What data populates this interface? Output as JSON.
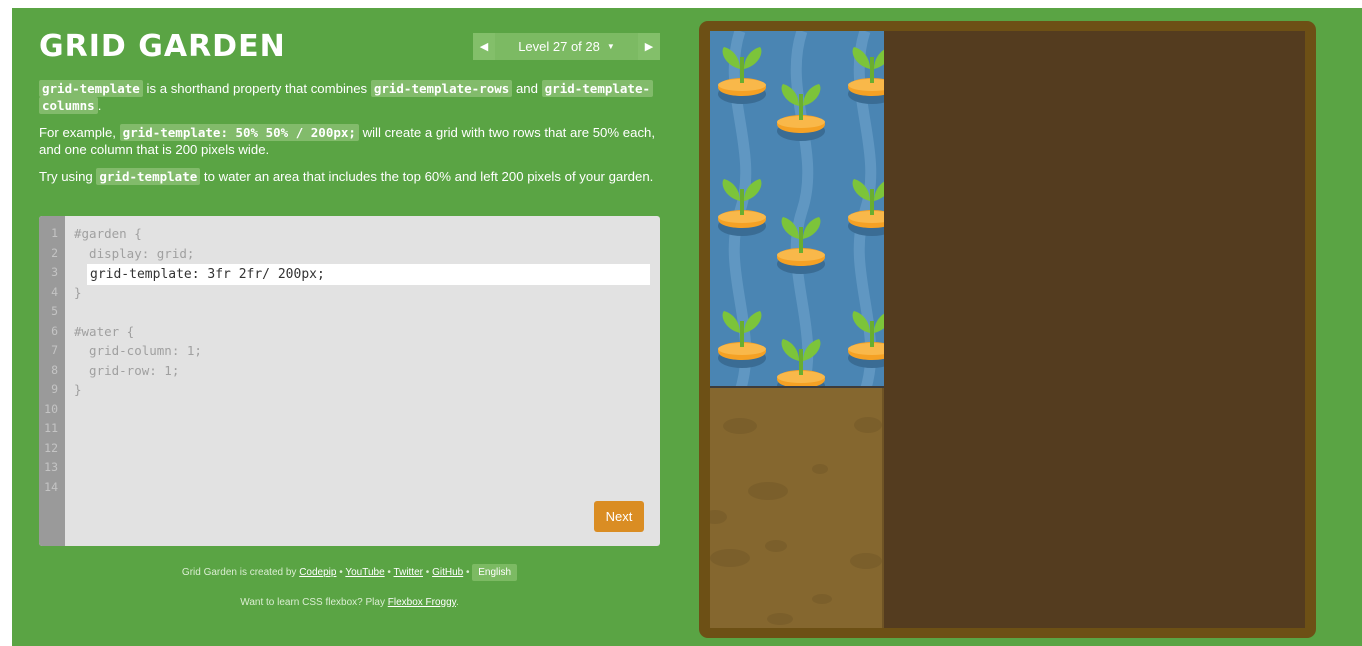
{
  "title": "GRID GARDEN",
  "level_nav": {
    "indicator": "Level 27 of 28",
    "prev_icon": "triangle-left-icon",
    "next_icon": "triangle-right-icon",
    "dropdown_icon": "caret-down-icon"
  },
  "instructions": {
    "p1": {
      "code1": "grid-template",
      "text1": " is a shorthand property that combines ",
      "code2": "grid-template-rows",
      "text2": " and ",
      "code3": "grid-template-columns",
      "text3": "."
    },
    "p2": {
      "text1": "For example, ",
      "code1": "grid-template: 50% 50% / 200px;",
      "text2": " will create a grid with two rows that are 50% each, and one column that is 200 pixels wide."
    },
    "p3": {
      "text1": "Try using ",
      "code1": "grid-template",
      "text2": " to water an area that includes the top 60% and left 200 pixels of your garden."
    }
  },
  "editor": {
    "line_numbers": [
      "1",
      "2",
      "3",
      "4",
      "5",
      "6",
      "7",
      "8",
      "9",
      "10",
      "11",
      "12",
      "13",
      "14"
    ],
    "code_before": [
      "#garden {",
      "  display: grid;"
    ],
    "input_value": "grid-template: 3fr 2fr/ 200px;",
    "code_after": [
      "}",
      "",
      "#water {",
      "  grid-column: 1;",
      "  grid-row: 1;",
      "}"
    ],
    "next_label": "Next"
  },
  "footer": {
    "created_by": "Grid Garden is created by ",
    "codepip": "Codepip",
    "sep": " • ",
    "youtube": "YouTube",
    "twitter": "Twitter",
    "github": "GitHub",
    "language": "English",
    "flexbox_prompt": "Want to learn CSS flexbox? Play ",
    "flexbox_link": "Flexbox Froggy",
    "flexbox_end": "."
  },
  "colors": {
    "background": "#5aa444",
    "code_highlight": "#82bb6b",
    "next_button": "#da8d23",
    "garden_border": "#6d5015",
    "soil": "#543c1f",
    "watered_plot": "#85672f",
    "water": "#4a85b3",
    "carrot": "#f5a124",
    "leaf": "#7cc43a"
  },
  "garden": {
    "plant_icon": "carrot-icon",
    "carrot_count": 9
  }
}
